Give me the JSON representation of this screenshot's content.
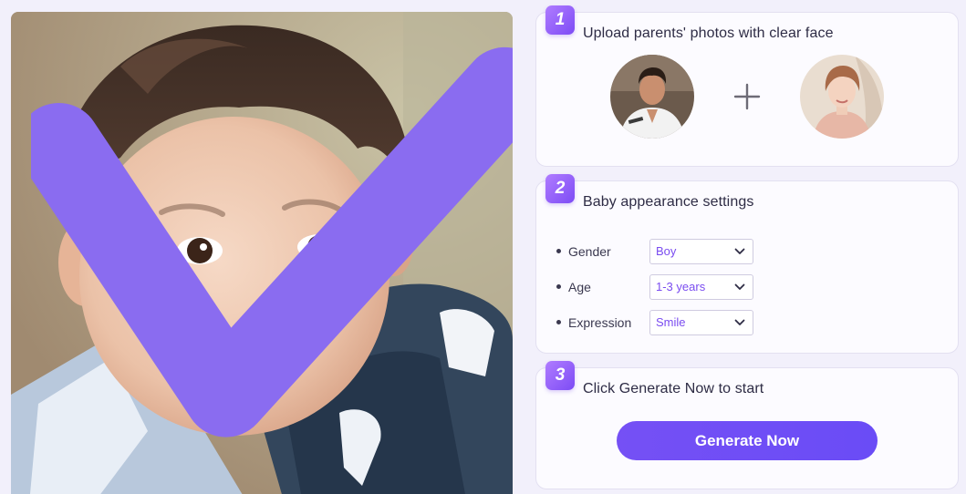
{
  "preview": {
    "image": "generated-baby-portrait"
  },
  "steps": [
    {
      "number": "1",
      "title": "Upload parents' photos with clear face"
    },
    {
      "number": "2",
      "title": "Baby appearance settings"
    },
    {
      "number": "3",
      "title": "Click Generate Now to start"
    }
  ],
  "upload": {
    "father_image": "father-photo",
    "mother_image": "mother-photo",
    "plus_icon": "plus-icon"
  },
  "settings": [
    {
      "label": "Gender",
      "value": "Boy"
    },
    {
      "label": "Age",
      "value": "1-3 years"
    },
    {
      "label": "Expression",
      "value": "Smile"
    }
  ],
  "generate": {
    "label": "Generate Now"
  },
  "colors": {
    "accent": "#7550f5",
    "badge_start": "#b07cff",
    "badge_end": "#7d4cf5",
    "select_text": "#7a4cf0",
    "background": "#f2f0fb"
  }
}
